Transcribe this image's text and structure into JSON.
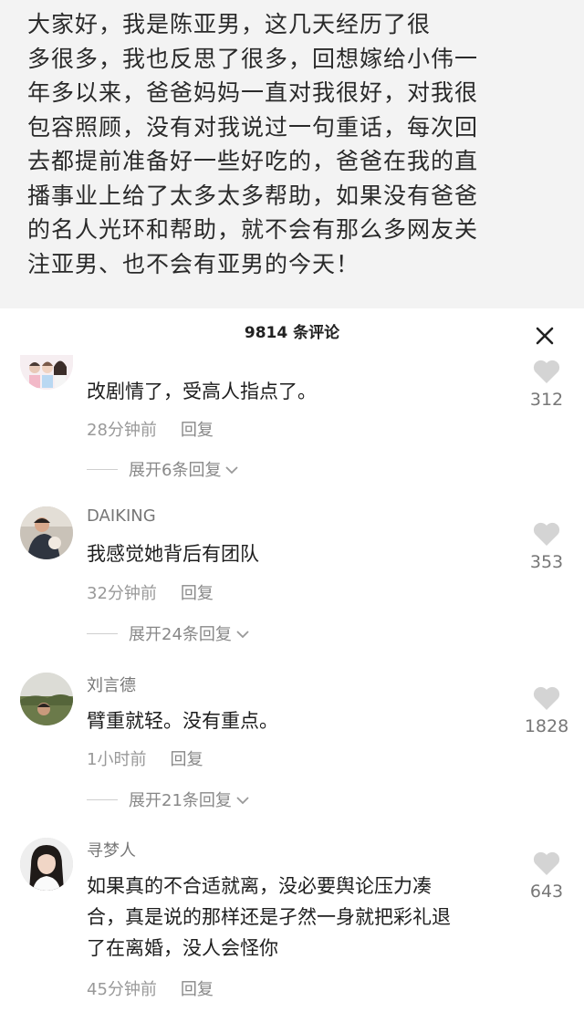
{
  "post": {
    "text": "大家好，我是陈亚男，这几天经历了很\n多很多，我也反思了很多，回想嫁给小伟一\n年多以来，爸爸妈妈一直对我很好，对我很\n包容照顾，没有对我说过一句重话，每次回\n去都提前准备好一些好吃的，爸爸在我的直\n播事业上给了太多太多帮助，如果没有爸爸\n的名人光环和帮助，就不会有那么多网友关\n注亚男、也不会有亚男的今天！"
  },
  "comments_header": {
    "count_label": "9814 条评论",
    "close_icon": "close-icon"
  },
  "comments": [
    {
      "username": "",
      "text": "改剧情了，受高人指点了。",
      "time": "28分钟前",
      "reply_label": "回复",
      "expand_label": "展开6条回复",
      "likes": "312"
    },
    {
      "username": "DAIKING",
      "text": "我感觉她背后有团队",
      "time": "32分钟前",
      "reply_label": "回复",
      "expand_label": "展开24条回复",
      "likes": "353"
    },
    {
      "username": "刘言德",
      "text": "臂重就轻。没有重点。",
      "time": "1小时前",
      "reply_label": "回复",
      "expand_label": "展开21条回复",
      "likes": "1828"
    },
    {
      "username": "寻梦人",
      "text": "如果真的不合适就离，没必要舆论压力凑\n合，真是说的那样还是孑然一身就把彩礼退\n了在离婚，没人会怪你",
      "time": "45分钟前",
      "reply_label": "回复",
      "expand_label": "",
      "likes": "643"
    }
  ],
  "colors": {
    "post_bg": "#f3f3f3",
    "like_icon": "#d4d4d4",
    "meta_text": "#999999"
  }
}
